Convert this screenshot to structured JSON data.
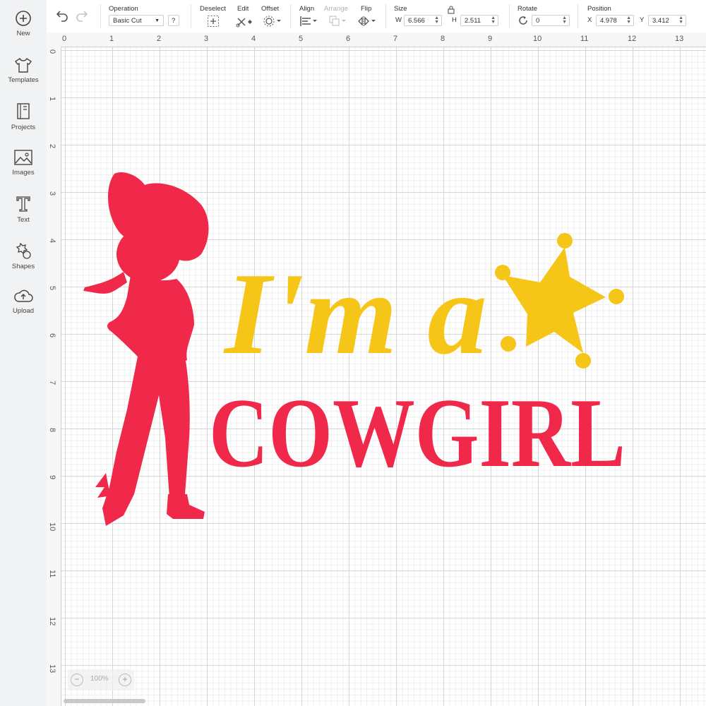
{
  "sidebar": {
    "items": [
      {
        "label": "New",
        "icon": "plus-circle-icon"
      },
      {
        "label": "Templates",
        "icon": "tshirt-icon"
      },
      {
        "label": "Projects",
        "icon": "notebook-icon"
      },
      {
        "label": "Images",
        "icon": "image-icon"
      },
      {
        "label": "Text",
        "icon": "text-icon"
      },
      {
        "label": "Shapes",
        "icon": "shapes-icon"
      },
      {
        "label": "Upload",
        "icon": "cloud-upload-icon"
      }
    ]
  },
  "toolbar": {
    "operation_label": "Operation",
    "operation_value": "Basic Cut",
    "help": "?",
    "deselect_label": "Deselect",
    "edit_label": "Edit",
    "offset_label": "Offset",
    "align_label": "Align",
    "arrange_label": "Arrange",
    "flip_label": "Flip",
    "size_label": "Size",
    "w_letter": "W",
    "w_value": "6.566",
    "h_letter": "H",
    "h_value": "2.511",
    "rotate_label": "Rotate",
    "rotate_value": "0",
    "position_label": "Position",
    "x_letter": "X",
    "x_value": "4.978",
    "y_letter": "Y",
    "y_value": "3.412"
  },
  "ruler": {
    "top": [
      "0",
      "1",
      "2",
      "3",
      "4",
      "5",
      "6",
      "7",
      "8",
      "9",
      "10",
      "11",
      "12",
      "13"
    ],
    "left": [
      "0",
      "1",
      "2",
      "3",
      "4",
      "5",
      "6",
      "7",
      "8",
      "9",
      "10",
      "11",
      "12",
      "13"
    ]
  },
  "design": {
    "line1": "I'm a",
    "line2": "COWGIRL",
    "yellow": "#f5c518",
    "red": "#f0294a"
  },
  "zoom": {
    "value": "100%",
    "minus": "−",
    "plus": "+"
  }
}
